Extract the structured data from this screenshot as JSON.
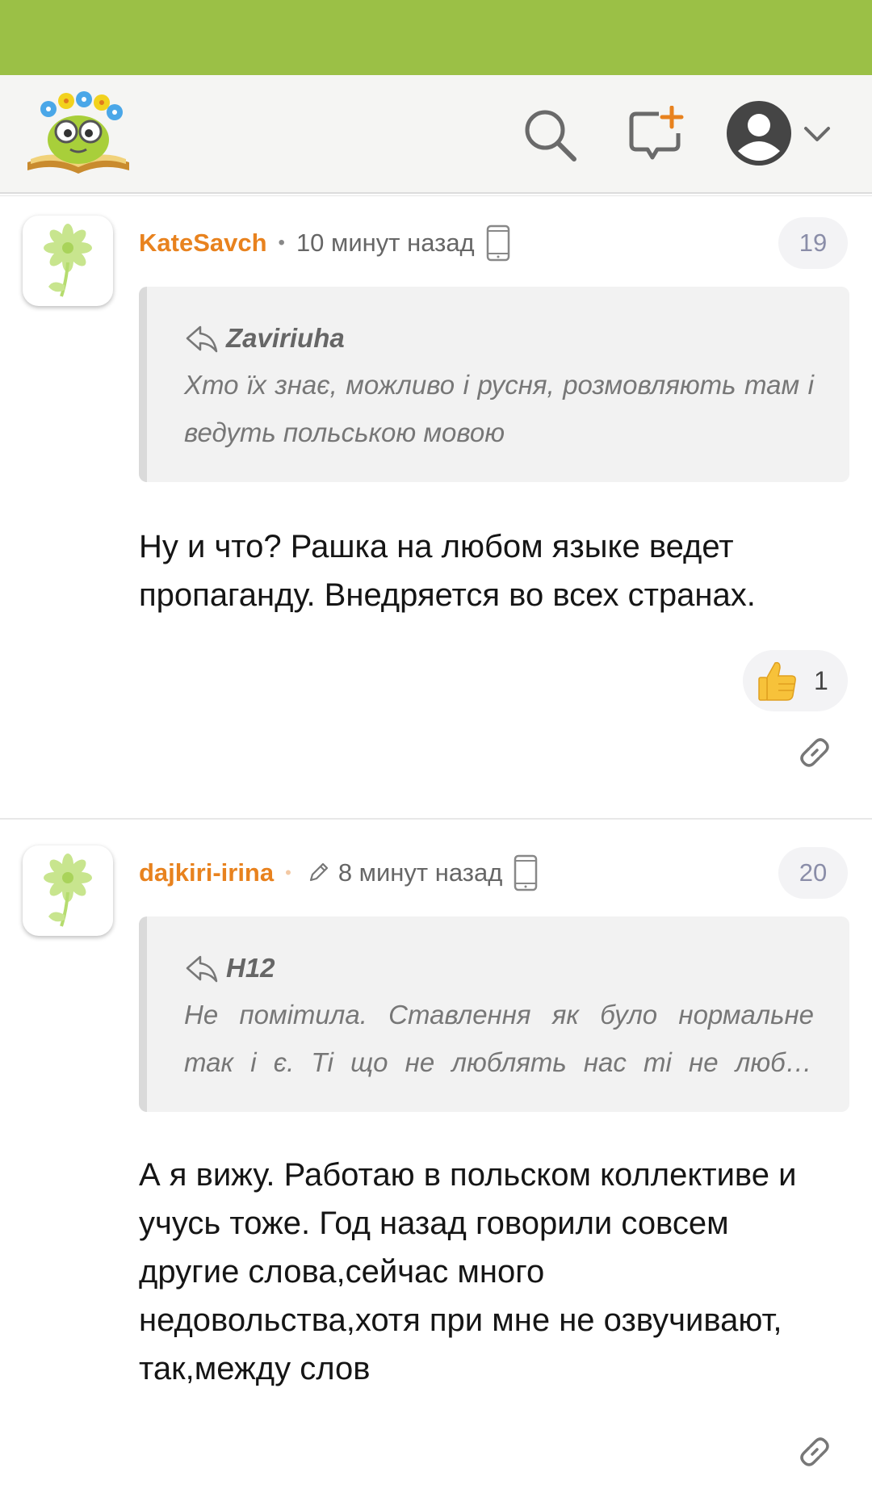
{
  "header": {
    "logo_icon": "book-mascot-logo",
    "search_icon": "search-icon",
    "compose_icon": "new-message-icon",
    "avatar_icon": "user-avatar-icon",
    "menu_icon": "chevron-down-icon"
  },
  "colors": {
    "status_bar": "#9bc046",
    "username": "#e8821e",
    "quote_bg": "#f2f2f2"
  },
  "comments": [
    {
      "username": "KateSavch",
      "time": "10 минут назад",
      "number": "19",
      "quote": {
        "author": "Zaviriuha",
        "text": "Хто їх знає, можливо і русня, розмовляють там і ведуть польською мовою"
      },
      "body": "Ну и что? Рашка на любом языке ведет пропаганду. Внедряется во всех странах.",
      "likes": "1"
    },
    {
      "username": "dajkiri-irina",
      "time": "8 минут назад",
      "number": "20",
      "quote": {
        "author": "H12",
        "line1": "Не помітила. Ставлення як було нормальне",
        "line2": "так і є. Ті що не люблять нас ті не люби..."
      },
      "body": "А я вижу. Работаю в польском коллективе и учусь тоже. Год назад говорили совсем другие слова,сейчас много недовольства,хотя при мне не озвучивают, так,между слов"
    }
  ]
}
